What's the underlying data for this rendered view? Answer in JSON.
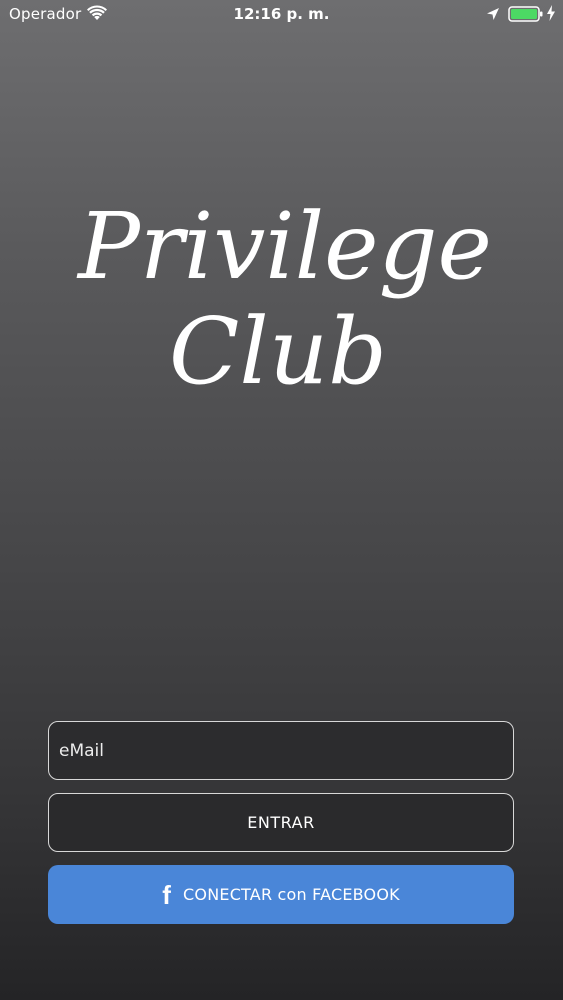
{
  "status_bar": {
    "carrier": "Operador",
    "time": "12:16 p. m.",
    "battery_level": 1.0,
    "battery_color": "#4cd964"
  },
  "logo": {
    "line1": "Privilege",
    "line2": "Club"
  },
  "login": {
    "email_placeholder": "eMail",
    "enter_label": "ENTRAR",
    "facebook_icon": "f",
    "facebook_label": "CONECTAR con FACEBOOK",
    "facebook_color": "#4a86d8"
  }
}
